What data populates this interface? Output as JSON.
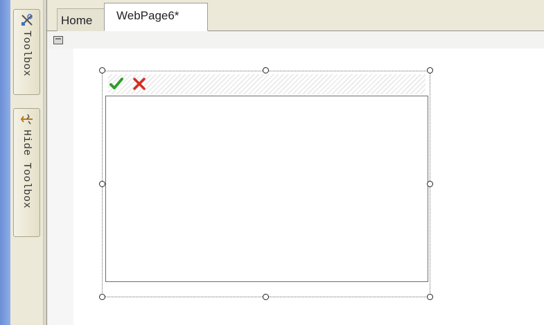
{
  "toolbox_panel": {
    "toolbox_label": "Toolbox",
    "hide_toolbox_label": "Hide Toolbox",
    "toolbox_icon": "toolbox-icon",
    "hide_icon": "pin-icon"
  },
  "tabs": [
    {
      "label": "Home"
    },
    {
      "label": "WebPage6*"
    }
  ],
  "designer": {
    "page_icon": "page-icon",
    "commands": [
      {
        "name": "accept",
        "icon": "checkmark-icon",
        "color": "#2e9d2e"
      },
      {
        "name": "cancel",
        "icon": "x-icon",
        "color": "#d62a1e"
      }
    ]
  }
}
